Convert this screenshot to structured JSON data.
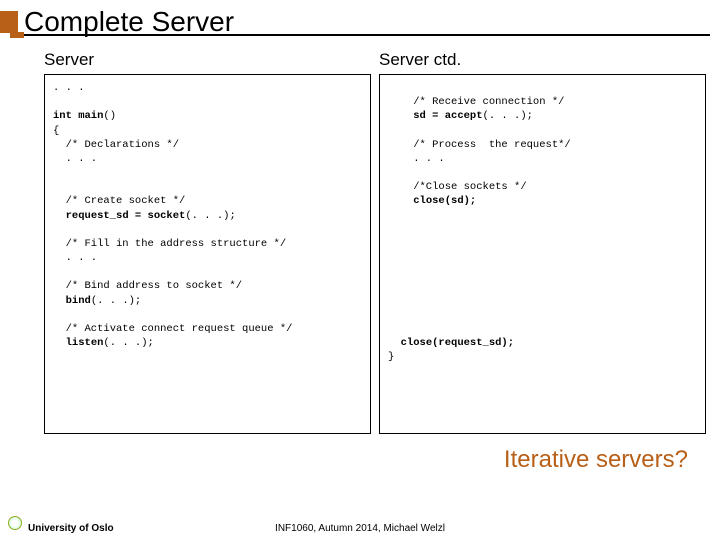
{
  "title": "Complete Server",
  "left": {
    "heading": "Server",
    "code": ". . .\n\nint main()\n{\n  /* Declarations */\n  . . .\n\n\n  /* Create socket */\n  request_sd = socket(. . .);\n\n  /* Fill in the address structure */\n  . . .\n\n  /* Bind address to socket */\n  bind(. . .);\n\n  /* Activate connect request queue */\n  listen(. . .);"
  },
  "right": {
    "heading": "Server ctd.",
    "code": "\n    /* Receive connection */\n    sd = accept(. . .);\n\n    /* Process  the request*/\n    . . .\n\n    /*Close sockets */\n    close(sd);\n\n\n\n\n\n\n\n\n\n  close(request_sd);\n}"
  },
  "subq": "Iterative servers?",
  "footer": {
    "uni": "University of Oslo",
    "course": "INF1060, Autumn 2014, Michael Welzl"
  }
}
